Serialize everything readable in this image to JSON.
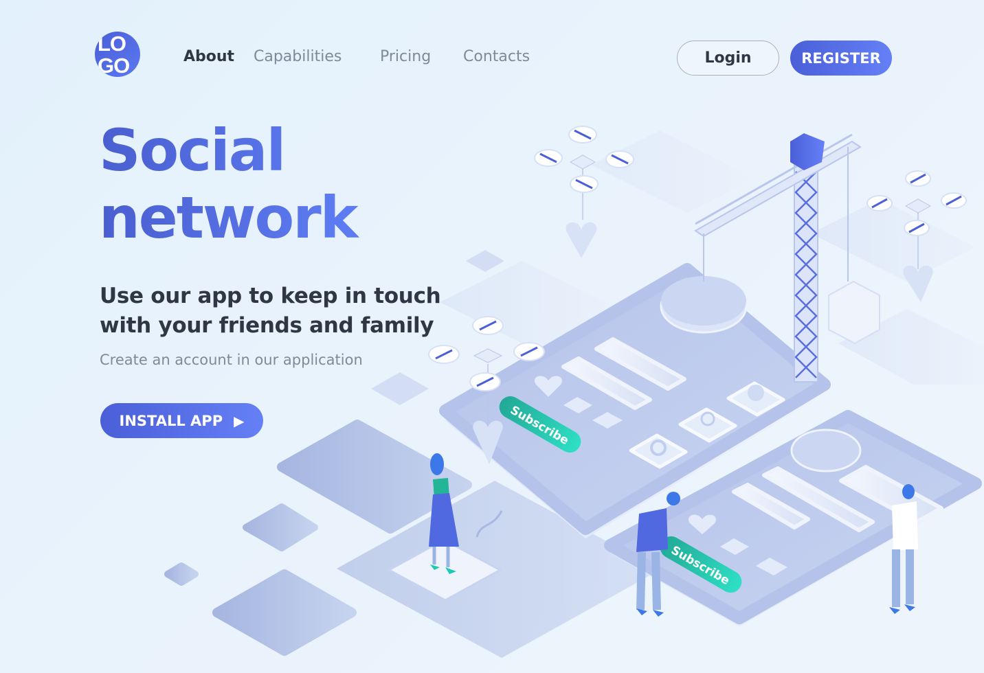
{
  "header": {
    "logo": {
      "line1": "LO",
      "line2": "GO"
    },
    "nav": [
      {
        "label": "About",
        "active": true
      },
      {
        "label": "Capabilities",
        "active": false
      },
      {
        "label": "Pricing",
        "active": false
      },
      {
        "label": "Contacts",
        "active": false
      }
    ],
    "login_label": "Login",
    "register_label": "REGISTER"
  },
  "hero": {
    "title_line1": "Social",
    "title_line2": "network",
    "subtitle_line1": "Use our app to keep in touch",
    "subtitle_line2": "with your friends and family",
    "description": "Create an account in our application",
    "cta_label": "INSTALL APP",
    "cta_icon": "play-icon"
  },
  "illustration": {
    "subscribe_label_1": "Subscribe",
    "subscribe_label_2": "Subscribe"
  },
  "colors": {
    "accent": "#5068e0",
    "accent_light": "#6580f6",
    "teal": "#1fc8b0",
    "text_dark": "#2f3744",
    "text_muted": "#7f8a98",
    "background": "#e6f2fc"
  }
}
